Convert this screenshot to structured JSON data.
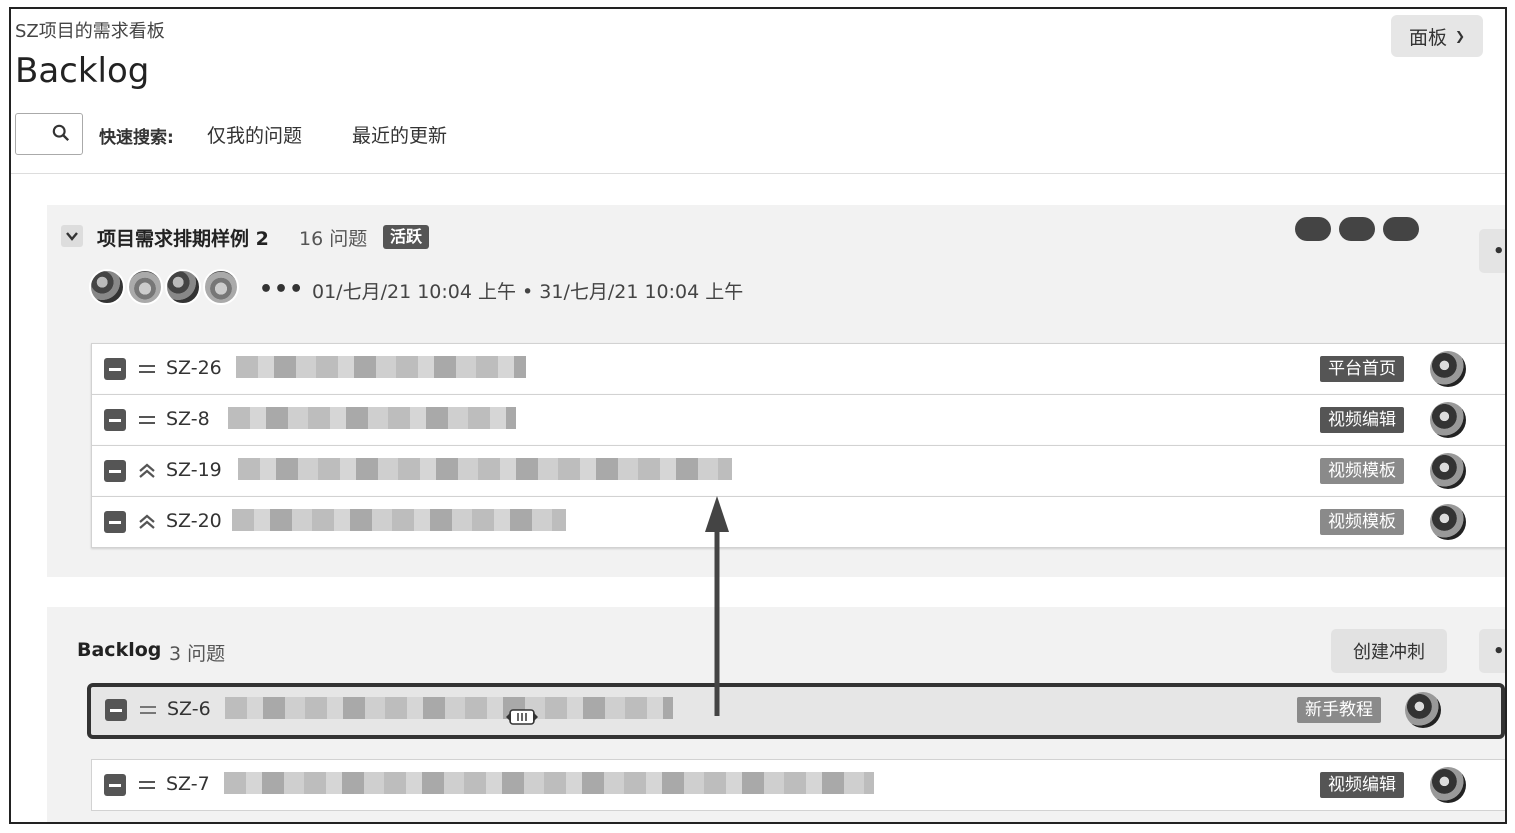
{
  "header": {
    "breadcrumb": "SZ项目的需求看板",
    "title": "Backlog",
    "board_button": "面板"
  },
  "quick_search": {
    "label": "快速搜索:",
    "filters": [
      "仅我的问题",
      "最近的更新"
    ]
  },
  "sprint": {
    "name": "项目需求排期样例 2",
    "count": "16 问题",
    "badge": "活跃",
    "more": "•••",
    "avatar_more": "•••",
    "dates": "01/七月/21 10:04 上午 • 31/七月/21 10:04 上午",
    "issues": [
      {
        "key": "SZ-26",
        "label": "平台首页",
        "priority": "medium"
      },
      {
        "key": "SZ-8",
        "label": "视频编辑",
        "priority": "medium"
      },
      {
        "key": "SZ-19",
        "label": "视频模板",
        "priority": "high"
      },
      {
        "key": "SZ-20",
        "label": "视频模板",
        "priority": "high"
      }
    ]
  },
  "backlog": {
    "name": "Backlog",
    "count": "3 问题",
    "create_sprint": "创建冲刺",
    "more": "••",
    "dragging_issue": {
      "key": "SZ-6",
      "label": "新手教程",
      "priority": "medium"
    },
    "issues": [
      {
        "key": "SZ-7",
        "label": "视频编辑",
        "priority": "medium"
      }
    ]
  },
  "colors": {
    "badge": "#555555",
    "panel_bg": "#f2f2f2",
    "drag_border": "#333333"
  }
}
